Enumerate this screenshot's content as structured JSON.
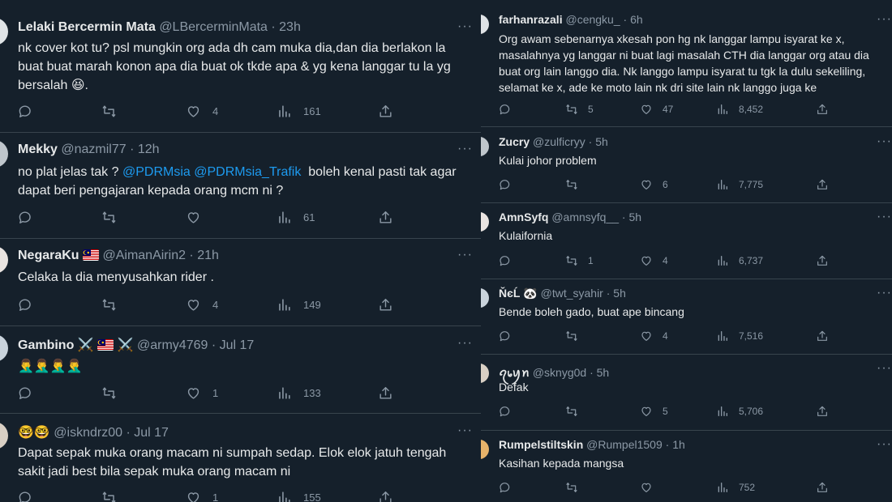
{
  "left_tweets": [
    {
      "name": "Lelaki Bercermin Mata",
      "handle": "@LBercerminMata",
      "time": "23h",
      "text": "nk cover kot tu? psl mungkin org ada dh cam muka dia,dan dia berlakon la buat buat marah konon apa dia buat ok tkde apa & yg kena langgar tu la yg bersalah 😆.",
      "replies": "",
      "retweets": "",
      "likes": "4",
      "views": "161"
    },
    {
      "name": "Mekky",
      "handle": "@nazmil77",
      "time": "12h",
      "text_parts": [
        "no plat jelas tak ? ",
        "@PDRMsia",
        " ",
        "@PDRMsia_Trafik",
        "  boleh kenal pasti tak agar dapat beri pengajaran kepada orang mcm ni ?"
      ],
      "replies": "",
      "retweets": "",
      "likes": "",
      "views": "61"
    },
    {
      "name": "NegaraKu",
      "handle": "@AimanAirin2",
      "time": "21h",
      "text": "Celaka la dia menyusahkan rider .",
      "replies": "",
      "retweets": "",
      "likes": "4",
      "views": "149"
    },
    {
      "name": "Gambino",
      "name_emoji": "⚔️",
      "handle": "@army4769",
      "time": "Jul 17",
      "text": "🤦‍♂️🤦‍♂️🤦‍♂️🤦‍♂️",
      "replies": "",
      "retweets": "",
      "likes": "1",
      "views": "133"
    },
    {
      "name": "🤓🤓",
      "handle": "@iskndrz00",
      "time": "Jul 17",
      "text": "Dapat sepak muka orang macam ni sumpah sedap. Elok elok jatuh tengah sakit jadi best bila sepak muka orang macam ni",
      "replies": "",
      "retweets": "",
      "likes": "1",
      "views": "155"
    }
  ],
  "right_tweets": [
    {
      "name": "farhanrazali",
      "handle": "@cengku_",
      "time": "6h",
      "text": "Org awam sebenarnya xkesah pon hg nk langgar lampu isyarat ke x,\nmasalahnya yg langgar ni buat lagi masalah CTH dia langgar org atau dia\nbuat org lain langgo dia. Nk langgo lampu isyarat tu tgk la dulu sekeliling,\nselamat ke x, ade ke moto lain nk dri site lain nk langgo juga ke",
      "replies": "",
      "retweets": "5",
      "likes": "47",
      "views": "8,452"
    },
    {
      "name": "Zucry",
      "handle": "@zulficryy",
      "time": "5h",
      "text": "Kulai johor problem",
      "replies": "",
      "retweets": "",
      "likes": "6",
      "views": "7,775"
    },
    {
      "name": "AmnSyfq",
      "handle": "@amnsyfq__",
      "time": "5h",
      "text": "Kulaifornia",
      "replies": "",
      "retweets": "1",
      "likes": "4",
      "views": "6,737"
    },
    {
      "name": "ŇєĹ 🐼",
      "handle": "@twt_syahir",
      "time": "5h",
      "text": "Bende boleh gado, buat ape bincang",
      "replies": "",
      "retweets": "",
      "likes": "4",
      "views": "7,516"
    },
    {
      "name": "ꪖ᥇ꪗꪀ",
      "handle": "@sknyg0d",
      "time": "5h",
      "text": "Defak",
      "replies": "",
      "retweets": "",
      "likes": "5",
      "views": "5,706"
    },
    {
      "name": "Rumpelstiltskin",
      "handle": "@Rumpel1509",
      "time": "1h",
      "text": "Kasihan kepada mangsa",
      "replies": "",
      "retweets": "",
      "likes": "",
      "views": "752"
    }
  ],
  "icons": {
    "reply": "reply-icon",
    "retweet": "retweet-icon",
    "like": "like-icon",
    "views": "views-icon",
    "share": "share-icon",
    "more": "more-icon"
  },
  "more_glyph": "···",
  "colors": {
    "background": "#15202b",
    "divider": "#38444d",
    "text": "#e7e9ea",
    "secondary": "#8b98a5",
    "link": "#1d9bf0"
  }
}
